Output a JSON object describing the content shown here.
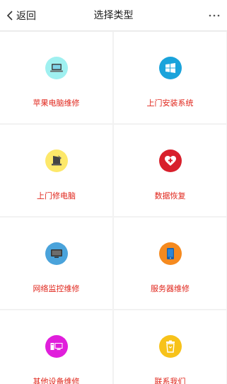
{
  "header": {
    "back_label": "返回",
    "title": "选择类型",
    "more_label": "···"
  },
  "items": [
    {
      "label": "苹果电脑维修",
      "icon": "laptop-icon",
      "color": "#9ff0f0"
    },
    {
      "label": "上门安装系统",
      "icon": "windows-icon",
      "color": "#1aa3db"
    },
    {
      "label": "上门修电脑",
      "icon": "tablet-icon",
      "color": "#fde86a"
    },
    {
      "label": "数据恢复",
      "icon": "medkit-heart-icon",
      "color": "#d8202c"
    },
    {
      "label": "网络监控维修",
      "icon": "monitor-icon",
      "color": "#4aa3db"
    },
    {
      "label": "服务器维修",
      "icon": "phone-icon",
      "color": "#f58a1f"
    },
    {
      "label": "其他设备维修",
      "icon": "desktop-icon",
      "color": "#e01edb"
    },
    {
      "label": "联系我们",
      "icon": "trash-bin-icon",
      "color": "#f7c21a"
    }
  ]
}
